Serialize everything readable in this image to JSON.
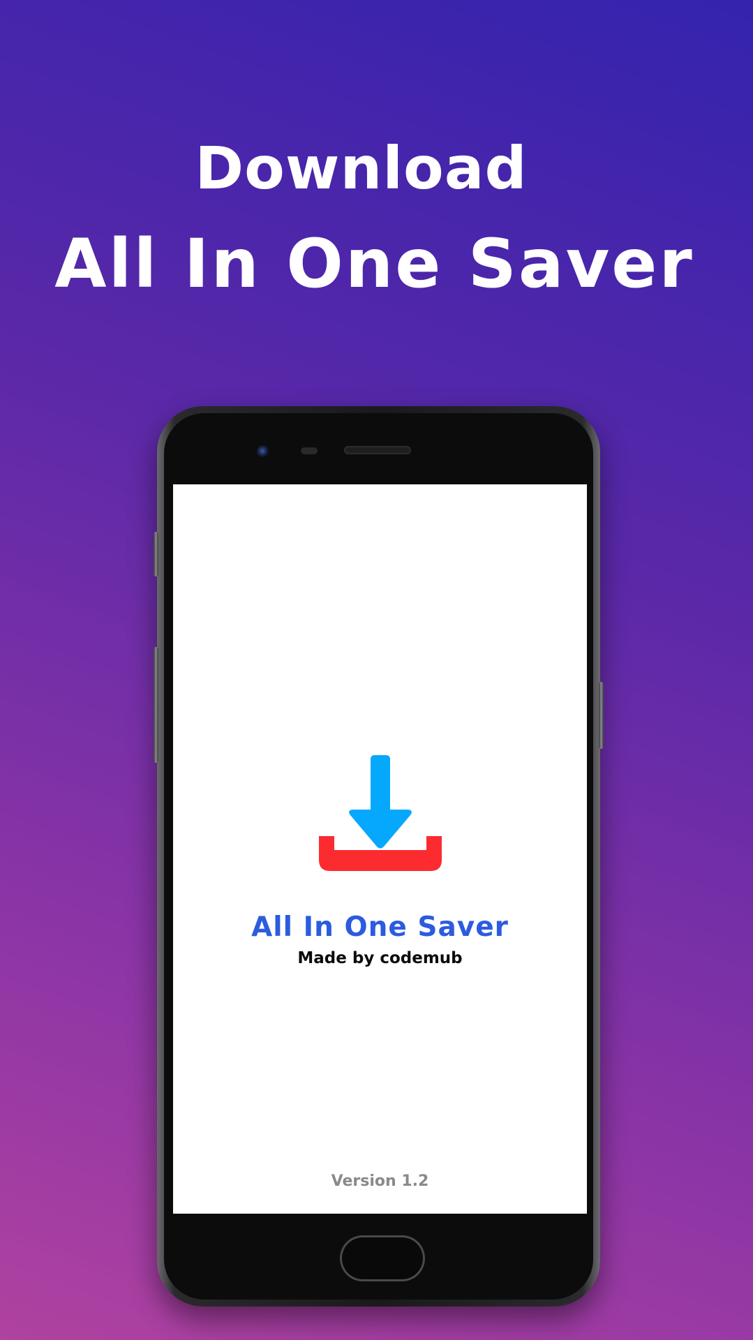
{
  "promo": {
    "headline_line1": "Download",
    "headline_line2": "All In One Saver"
  },
  "splash": {
    "logo_icon": "download-tray-icon",
    "app_name": "All In One Saver",
    "author": "Made by codemub",
    "version": "Version 1.2"
  },
  "colors": {
    "background_top": "#3423ae",
    "background_bottom": "#b042a0",
    "arrow": "#05a8fc",
    "tray": "#fb2b30",
    "app_name": "#2c5be0",
    "version": "#8a8a8a"
  }
}
